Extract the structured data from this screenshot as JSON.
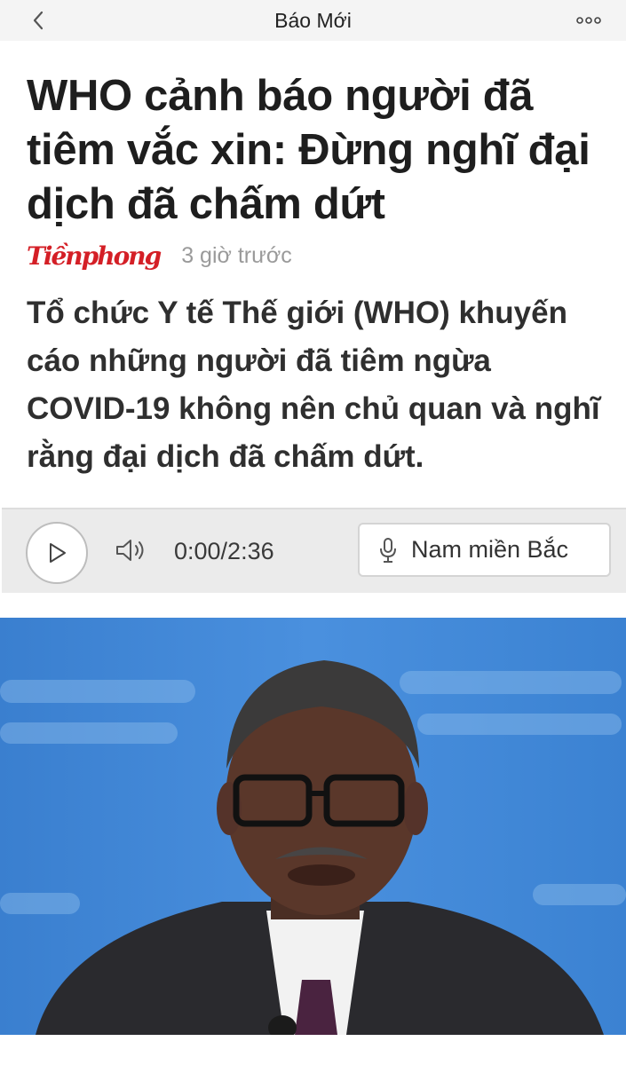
{
  "header": {
    "title": "Báo Mới",
    "back_icon": "chevron-left-icon",
    "more_icon": "more-horizontal-icon"
  },
  "article": {
    "headline": "WHO cảnh báo người đã tiêm vắc xin: Đừng nghĩ đại dịch đã chấm dứt",
    "source_name": "Tiềnphong",
    "source_time": "3 giờ trước",
    "summary": "Tổ chức Y tế Thế giới (WHO) khuyến cáo những người đã tiêm ngừa COVID-19 không nên chủ quan và nghĩ rằng đại dịch đã chấm dứt."
  },
  "audio": {
    "time": "0:00/2:36",
    "voice_label": "Nam miền Bắc",
    "play_icon": "play-icon",
    "volume_icon": "volume-icon",
    "mic_icon": "microphone-icon"
  },
  "colors": {
    "source_logo": "#d41f26",
    "topbar_bg": "#f4f4f4",
    "audio_bg": "#ebebeb",
    "photo_bg": "#3f86d6"
  }
}
